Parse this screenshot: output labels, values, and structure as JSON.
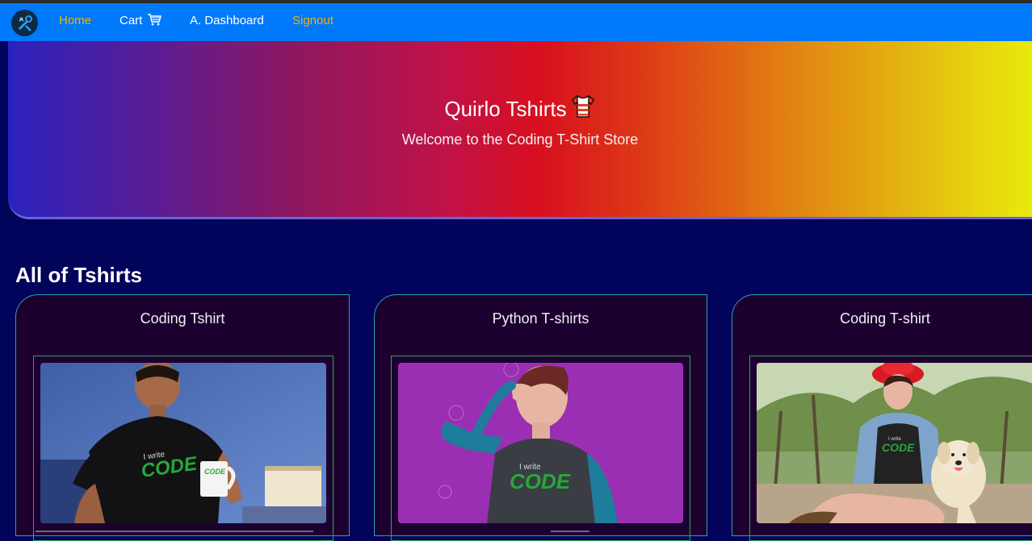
{
  "nav": {
    "logo_icon": "tshirt-tools-logo-icon",
    "home": "Home",
    "cart": "Cart",
    "cart_icon": "shopping-cart-icon",
    "dashboard": "A. Dashboard",
    "signout": "Signout",
    "bg_color": "#0079fb",
    "active_color": "#f5b100"
  },
  "hero": {
    "title": "Quirlo Tshirts",
    "title_icon": "tshirt-icon",
    "subtitle": "Welcome to the Coding T-Shirt Store"
  },
  "products_section": {
    "title": "All of Tshirts",
    "cards": [
      {
        "title": "Coding Tshirt",
        "image": "man-with-mug-wearing-i-write-code-tshirt"
      },
      {
        "title": "Python T-shirts",
        "image": "woman-on-purple-background-wearing-i-write-code-raglan"
      },
      {
        "title": "Coding T-shirt",
        "image": "woman-with-red-hat-and-dog-wearing-i-write-code-tshirt"
      }
    ],
    "shirt_text_top": "I write",
    "shirt_text_main": "CODE"
  }
}
